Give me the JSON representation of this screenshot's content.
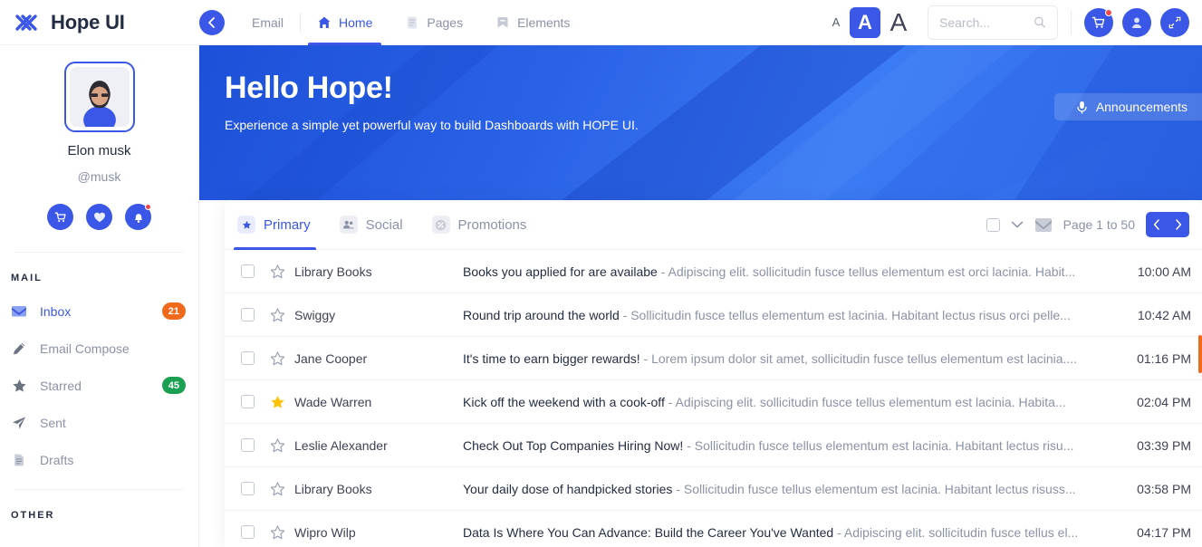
{
  "header": {
    "brand": "Hope UI",
    "brand_logo_icon": "hope-ui-logo-icon",
    "back_icon": "arrow-left-icon",
    "nav": [
      {
        "label": "Email",
        "icon": "back-label",
        "active": false
      },
      {
        "label": "Home",
        "icon": "home-icon",
        "active": true
      },
      {
        "label": "Pages",
        "icon": "pages-icon",
        "active": false
      },
      {
        "label": "Elements",
        "icon": "bookmark-icon",
        "active": false
      }
    ],
    "font_sizes": {
      "small": "A",
      "medium": "A",
      "large": "A",
      "selected": "A"
    },
    "search": {
      "value": "",
      "placeholder": "Search...",
      "icon": "search-icon"
    },
    "actions": [
      {
        "name": "cart-icon",
        "badge": true
      },
      {
        "name": "user-icon",
        "badge": false
      },
      {
        "name": "expand-icon",
        "badge": false
      }
    ]
  },
  "sidebar": {
    "profile": {
      "name": "Elon musk",
      "handle": "@musk",
      "avatar_icon": "user-avatar-illustration"
    },
    "profile_actions": [
      {
        "name": "cart-icon",
        "badge": false
      },
      {
        "name": "heart-icon",
        "badge": false
      },
      {
        "name": "bell-icon",
        "badge": true
      }
    ],
    "mail_heading": "MAIL",
    "other_heading": "OTHER",
    "items": [
      {
        "label": "Inbox",
        "icon": "inbox-envelope-icon",
        "badge": "21",
        "badge_color": "orange",
        "active": true
      },
      {
        "label": "Email Compose",
        "icon": "pencil-icon",
        "badge": "",
        "badge_color": "",
        "active": false
      },
      {
        "label": "Starred",
        "icon": "star-icon",
        "badge": "45",
        "badge_color": "green",
        "active": false
      },
      {
        "label": "Sent",
        "icon": "send-icon",
        "badge": "",
        "badge_color": "",
        "active": false
      },
      {
        "label": "Drafts",
        "icon": "draft-file-icon",
        "badge": "",
        "badge_color": "",
        "active": false
      }
    ]
  },
  "hero": {
    "title": "Hello Hope!",
    "subtitle": "Experience a simple yet powerful way to build Dashboards with HOPE UI.",
    "announcements_label": "Announcements",
    "announcements_icon": "microphone-icon"
  },
  "mailbox": {
    "tabs": [
      {
        "label": "Primary",
        "icon": "primary-star-icon",
        "active": true
      },
      {
        "label": "Social",
        "icon": "social-people-icon",
        "active": false
      },
      {
        "label": "Promotions",
        "icon": "promotions-tag-icon",
        "active": false
      }
    ],
    "toolbar": {
      "select_all_checkbox": false,
      "select_dropdown_icon": "chevron-down-icon",
      "envelope_icon": "envelope-icon",
      "page_text": "Page 1 to 50",
      "prev_icon": "chevron-left-icon",
      "next_icon": "chevron-right-icon"
    },
    "rows": [
      {
        "sender": "Library Books",
        "subject": "Books you applied for are availabe",
        "preview": "- Adipiscing elit. sollicitudin fusce tellus elementum est orci lacinia. Habit...",
        "time": "10:00 AM",
        "starred": false,
        "checked": false
      },
      {
        "sender": "Swiggy",
        "subject": "Round trip around the world",
        "preview": "- Sollicitudin fusce tellus elementum est lacinia. Habitant lectus risus orci pelle...",
        "time": "10:42 AM",
        "starred": false,
        "checked": false
      },
      {
        "sender": "Jane Cooper",
        "subject": "It's time to earn bigger rewards!",
        "preview": "- Lorem ipsum dolor sit amet, sollicitudin fusce tellus elementum est lacinia....",
        "time": "01:16 PM",
        "starred": false,
        "checked": false
      },
      {
        "sender": "Wade Warren",
        "subject": "Kick off the weekend with a cook-off",
        "preview": "- Adipiscing elit. sollicitudin fusce tellus elementum est lacinia. Habita...",
        "time": "02:04 PM",
        "starred": true,
        "checked": false
      },
      {
        "sender": "Leslie Alexander",
        "subject": "Check Out Top Companies Hiring Now!",
        "preview": "- Sollicitudin fusce tellus elementum est lacinia. Habitant lectus risu...",
        "time": "03:39 PM",
        "starred": false,
        "checked": false
      },
      {
        "sender": "Library Books",
        "subject": "Your daily dose of handpicked stories",
        "preview": "- Sollicitudin fusce tellus elementum est lacinia. Habitant lectus risuss...",
        "time": "03:58 PM",
        "starred": false,
        "checked": false
      },
      {
        "sender": "Wipro Wilp",
        "subject": "Data Is Where You Can Advance: Build the Career You've Wanted",
        "preview": "- Adipiscing elit. sollicitudin fusce tellus el...",
        "time": "04:17 PM",
        "starred": false,
        "checked": false
      }
    ]
  },
  "colors": {
    "primary": "#3a57e8",
    "badge_orange": "#f16a1b",
    "badge_green": "#1aa053",
    "star_gold": "#ffc107",
    "text_dark": "#232d42",
    "text_muted": "#8a92a6"
  }
}
